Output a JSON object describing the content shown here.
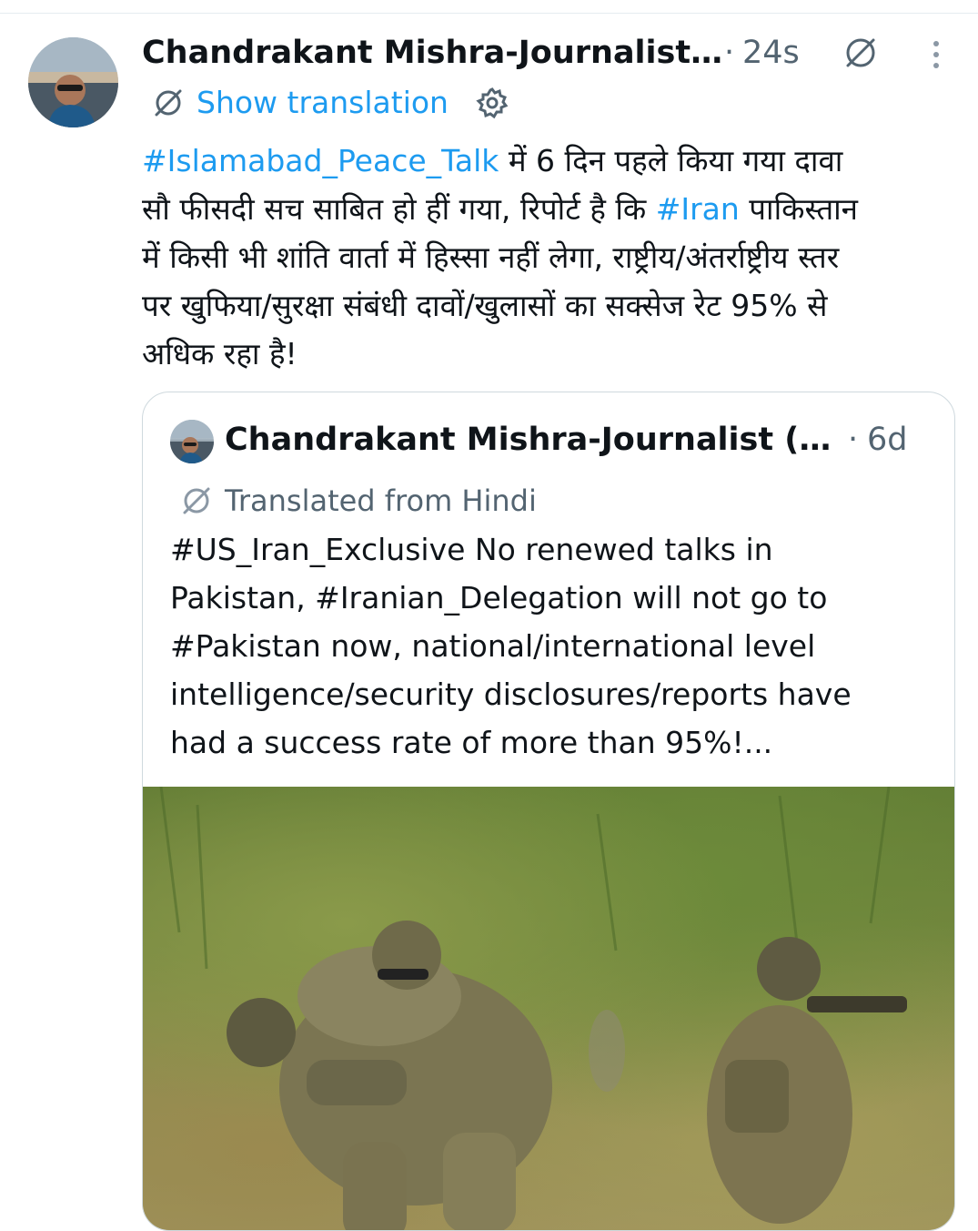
{
  "post": {
    "author_name": "Chandrakant Mishra-Journalist...",
    "separator": "·",
    "time": "24s",
    "show_translation": "Show translation",
    "text_lines": [
      [
        {
          "t": "#Islamabad_Peace_Talk",
          "tag": true
        },
        {
          "t": " में 6 दिन पहले किया गया दावा",
          "tag": false
        }
      ],
      [
        {
          "t": "सौ फीसदी सच साबित हो हीं गया, रिपोर्ट है कि ",
          "tag": false
        },
        {
          "t": "#Iran",
          "tag": true
        },
        {
          "t": " पाकिस्तान",
          "tag": false
        }
      ],
      [
        {
          "t": "में किसी भी शांति वार्ता में हिस्सा नहीं लेगा, राष्ट्रीय/अंतर्राष्ट्रीय स्तर",
          "tag": false
        }
      ],
      [
        {
          "t": "पर खुफिया/सुरक्षा संबंधी दावों/खुलासों का सक्सेज रेट 95% से",
          "tag": false
        }
      ],
      [
        {
          "t": "अधिक रहा है!",
          "tag": false
        }
      ]
    ]
  },
  "quote": {
    "author_name": "Chandrakant Mishra-Journalist (L...",
    "separator": "·",
    "time": "6d",
    "translated_label": "Translated from Hindi",
    "text_lines": [
      "#US_Iran_Exclusive No renewed talks in",
      "Pakistan, #Iranian_Delegation will not go to",
      "#Pakistan now, national/international level",
      "intelligence/security disclosures/reports have",
      "had a success rate of more than 95%!..."
    ]
  },
  "icons": {
    "grok": "grok-icon",
    "more": "more-vertical-icon",
    "translate": "translate-icon",
    "settings": "gear-icon"
  },
  "colors": {
    "accent": "#1d9bf0",
    "secondary_text": "#536471",
    "border": "#cfd9de"
  }
}
